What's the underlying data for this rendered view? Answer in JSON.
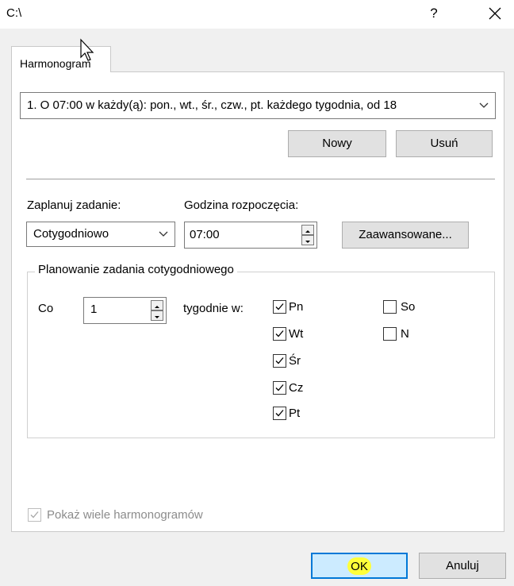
{
  "window": {
    "title": "C:\\",
    "help_label": "?",
    "close_label": "✕"
  },
  "tabs": [
    {
      "label": "Harmonogram"
    }
  ],
  "schedule": {
    "selected": "1. O 07:00 w każdy(ą): pon., wt., śr., czw., pt. każdego tygodnia, od 18",
    "new_label": "Nowy",
    "delete_label": "Usuń"
  },
  "task": {
    "schedule_label": "Zaplanuj zadanie:",
    "schedule_value": "Cotygodniowo",
    "start_label": "Godzina rozpoczęcia:",
    "start_value": "07:00",
    "advanced_label": "Zaawansowane..."
  },
  "weekly": {
    "group_title": "Planowanie zadania cotygodniowego",
    "every_label": "Co",
    "every_value": "1",
    "weeks_label": "tygodnie w:",
    "days": [
      {
        "label": "Pn",
        "checked": true
      },
      {
        "label": "Wt",
        "checked": true
      },
      {
        "label": "Śr",
        "checked": true
      },
      {
        "label": "Cz",
        "checked": true
      },
      {
        "label": "Pt",
        "checked": true
      },
      {
        "label": "So",
        "checked": false
      },
      {
        "label": "N",
        "checked": false
      }
    ]
  },
  "footer": {
    "multi_label": "Pokaż wiele harmonogramów",
    "multi_checked": true,
    "ok_label": "OK",
    "cancel_label": "Anuluj"
  },
  "colors": {
    "ok_border": "#0078d7",
    "highlight": "#ffff3a"
  }
}
